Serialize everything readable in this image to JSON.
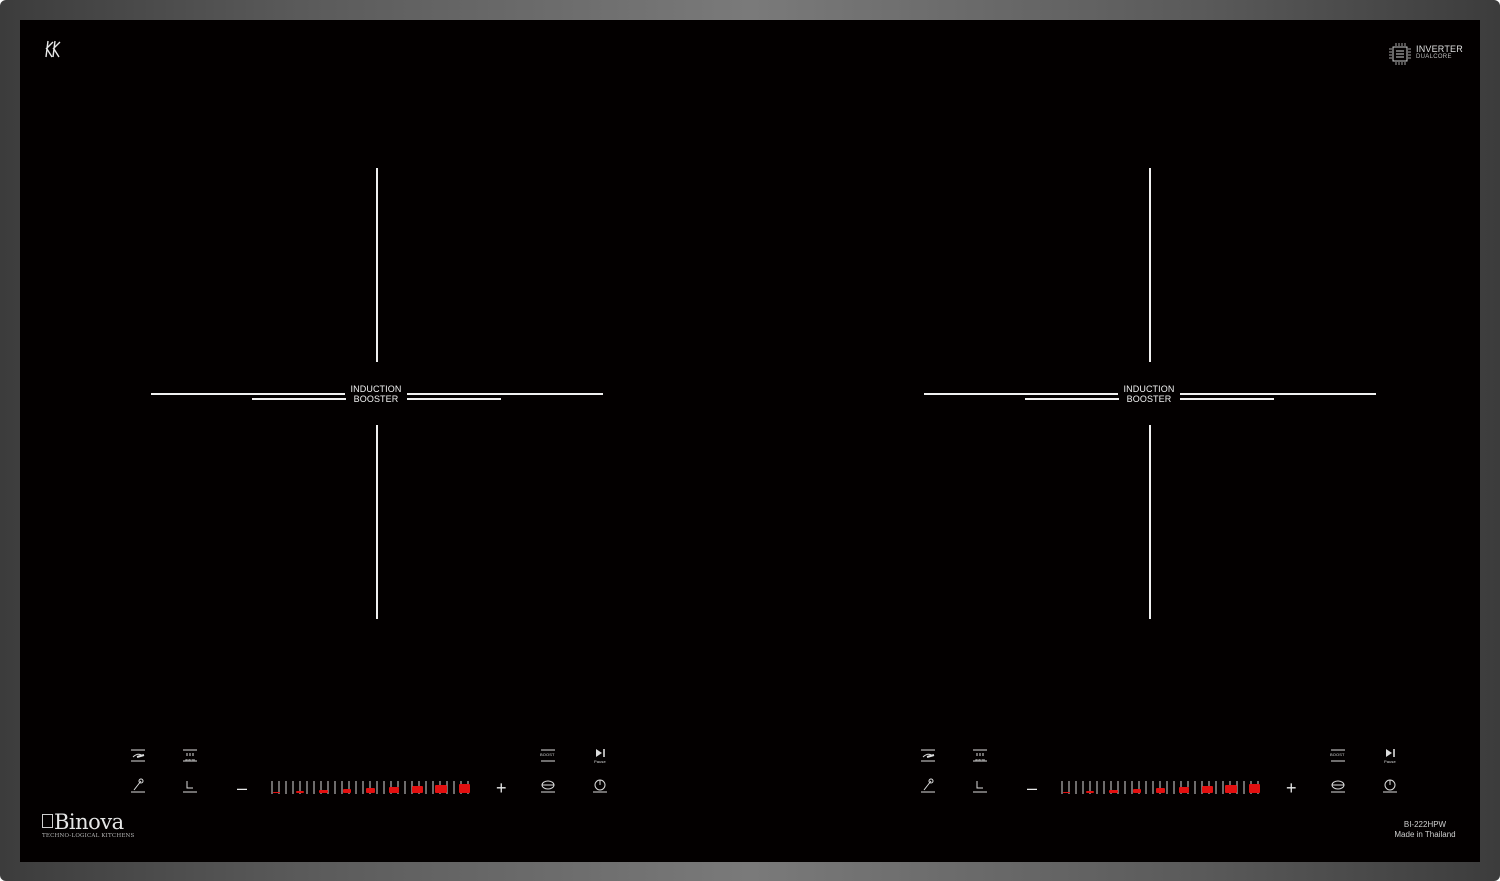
{
  "hob": {
    "brand": {
      "name": "Binova",
      "tagline": "TECHNO-LOGICAL KITCHENS"
    },
    "corner_logo": "\u0001K",
    "badge": {
      "line1": "INVERTER",
      "line2": "DUALCORE",
      "icon": "chip-icon"
    },
    "model": {
      "code": "BI-222HPW",
      "origin": "Made in Thailand"
    },
    "zones": [
      {
        "label_line1": "INDUCTION",
        "label_line2": "BOOSTER"
      },
      {
        "label_line1": "INDUCTION",
        "label_line2": "BOOSTER"
      }
    ],
    "controls": [
      {
        "top_icons": [
          "pan-icon",
          "heat-icon",
          "boost-icon",
          "play-pause-icon"
        ],
        "top_texts": {
          "heat": "warm",
          "boost": "BOOST",
          "pause": "Pause"
        },
        "bottom_icons": [
          "pan-detect-icon",
          "timer-icon",
          "pan-boost-icon",
          "power-icon"
        ],
        "minus": "–",
        "plus": "+",
        "power_level": 9,
        "power_max": 9
      },
      {
        "top_icons": [
          "pan-icon",
          "heat-icon",
          "boost-icon",
          "play-pause-icon"
        ],
        "top_texts": {
          "heat": "warm",
          "boost": "BOOST",
          "pause": "Pause"
        },
        "bottom_icons": [
          "pan-detect-icon",
          "timer-icon",
          "pan-boost-icon",
          "power-icon"
        ],
        "minus": "–",
        "plus": "+",
        "power_level": 9,
        "power_max": 9
      }
    ],
    "colors": {
      "glass": "#030000",
      "led": "#e31010",
      "frame": "#5a5a5a"
    }
  }
}
